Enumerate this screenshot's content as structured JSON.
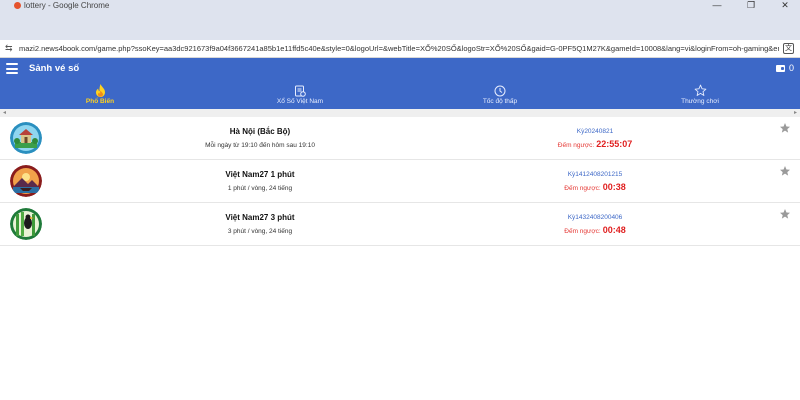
{
  "browser": {
    "window_title": "lottery - Google Chrome",
    "url": "mazi2.news4book.com/game.php?ssoKey=aa3dc921673f9a04f3667241a85b1e11ffd5c40e&style=0&logoUrl=&webTitle=XỔ%20SỐ&logoStr=XỔ%20SỐ&gaid=G-0PF5Q1M27K&gameId=10008&lang=vi&loginFrom=oh-gaming&env=..."
  },
  "header": {
    "title": "Sảnh vé số",
    "balance": "0"
  },
  "tabs": [
    {
      "label": "Phổ Biến",
      "icon": "fire-icon",
      "active": true
    },
    {
      "label": "Xổ Số Việt Nam",
      "icon": "ticket-icon",
      "active": false
    },
    {
      "label": "Tốc độ thấp",
      "icon": "clock-icon",
      "active": false
    },
    {
      "label": "Thường chơi",
      "icon": "star-icon",
      "active": false
    }
  ],
  "lotteries": [
    {
      "name": "Hà Nội (Bắc Bộ)",
      "schedule": "Mỗi ngày từ 19:10 đến hôm sau 19:10",
      "period": "Kỳ20240821",
      "countdown_label": "Đếm ngược:",
      "countdown": "22:55:07",
      "logo": "hanoi-temple"
    },
    {
      "name": "Việt Nam27 1 phút",
      "schedule": "1 phút / vòng, 24 tiếng",
      "period": "Kỳ1412408201215",
      "countdown_label": "Đếm ngược:",
      "countdown": "00:38",
      "logo": "vietnam-boat"
    },
    {
      "name": "Việt Nam27 3 phút",
      "schedule": "3 phút / vòng, 24 tiếng",
      "period": "Kỳ1432408200406",
      "countdown_label": "Đếm ngược:",
      "countdown": "00:48",
      "logo": "bamboo-bird"
    }
  ],
  "colors": {
    "primary": "#3d68c7",
    "active_tab": "#ffd21f",
    "countdown": "#e02020",
    "period": "#3d68c7"
  }
}
